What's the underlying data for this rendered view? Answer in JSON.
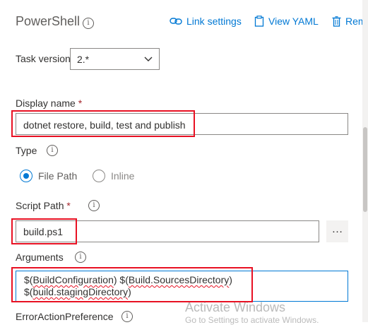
{
  "header": {
    "title": "PowerShell",
    "link_settings": "Link settings",
    "view_yaml": "View YAML",
    "remove": "Rem"
  },
  "task_version": {
    "label": "Task version",
    "value": "2.*"
  },
  "display_name": {
    "label": "Display name",
    "required_mark": "*",
    "value": "dotnet restore, build, test and publish"
  },
  "type": {
    "label": "Type",
    "options": [
      {
        "label": "File Path",
        "selected": true
      },
      {
        "label": "Inline",
        "selected": false
      }
    ]
  },
  "script_path": {
    "label": "Script Path",
    "required_mark": "*",
    "value": "build.ps1",
    "browse_label": "…"
  },
  "arguments": {
    "label": "Arguments",
    "line1_part1": "$(",
    "line1_word1": "BuildConfiguration",
    "line1_part2": ") $(",
    "line1_word2": "Build.SourcesDirectory",
    "line1_part3": ")",
    "line2_part1": "$(",
    "line2_word1": "build.stagingDirectory",
    "line2_part2": ")"
  },
  "error_action": {
    "label": "ErrorActionPreference"
  },
  "watermark": {
    "line1": "Activate Windows",
    "line2": "Go to Settings to activate Windows."
  },
  "colors": {
    "accent": "#0078d4",
    "highlight": "#e81123"
  }
}
